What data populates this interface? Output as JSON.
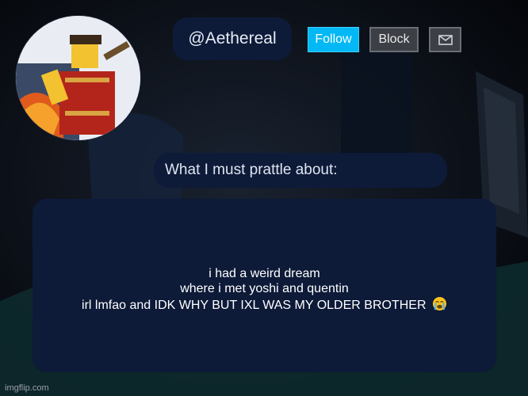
{
  "profile": {
    "username": "@Aethereal",
    "follow_label": "Follow",
    "block_label": "Block",
    "message_icon": "envelope-icon"
  },
  "about": {
    "heading": "What I must prattle about:",
    "lines": [
      "i had a weird dream",
      "where i met yoshi and quentin",
      "irl lmfao and IDK WHY BUT IXL WAS MY OLDER BROTHER"
    ],
    "emoji_icon": "crying-face-icon"
  },
  "watermark": "imgflip.com",
  "colors": {
    "panel": "#0d1a38",
    "follow": "#02b8f5",
    "block": "#3c3f45"
  }
}
